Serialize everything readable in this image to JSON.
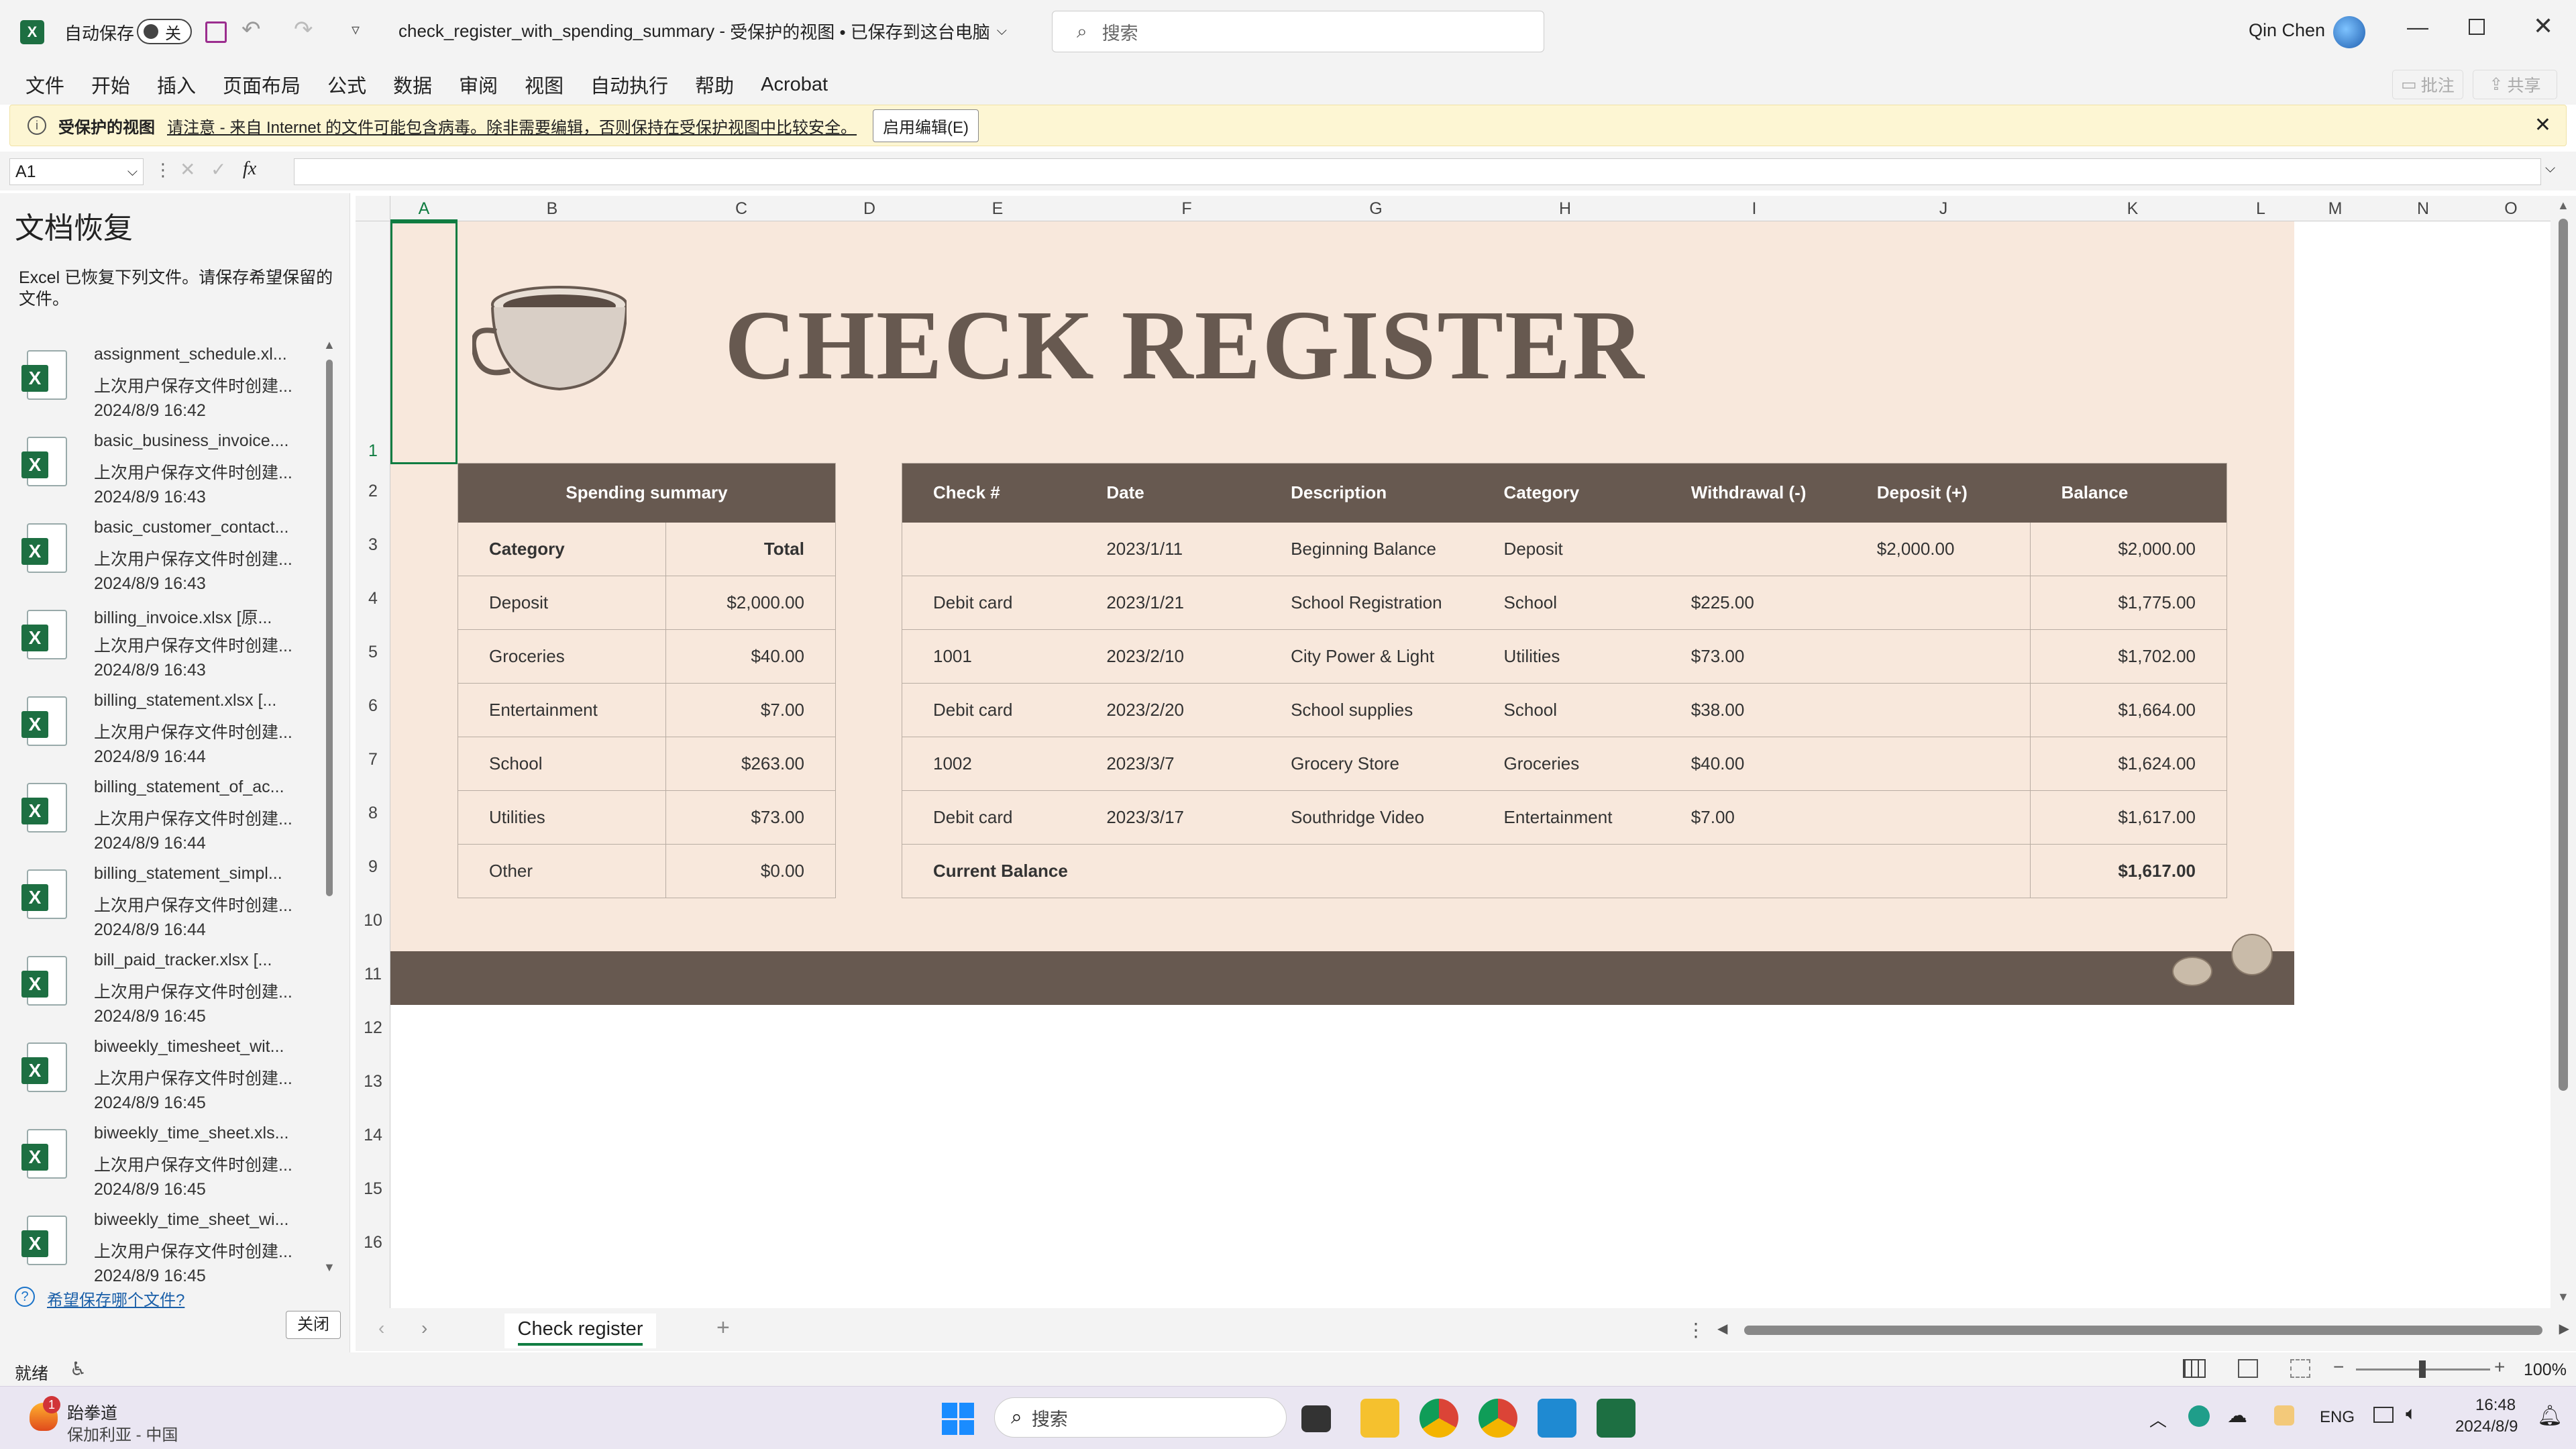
{
  "titlebar": {
    "autosave_label": "自动保存",
    "autosave_state": "关",
    "filename": "check_register_with_spending_summary",
    "title_sep": " - ",
    "view_status": "受保护的视图 • 已保存到这台电脑",
    "search_placeholder": "搜索",
    "user_name": "Qin Chen"
  },
  "menu": {
    "items": [
      "文件",
      "开始",
      "插入",
      "页面布局",
      "公式",
      "数据",
      "审阅",
      "视图",
      "自动执行",
      "帮助",
      "Acrobat"
    ],
    "comments": "批注",
    "share": "共享"
  },
  "protected": {
    "label": "受保护的视图",
    "message": "请注意 - 来自 Internet 的文件可能包含病毒。除非需要编辑，否则保持在受保护视图中比较安全。",
    "enable_button": "启用编辑(E)"
  },
  "formula": {
    "name_box": "A1",
    "fx": "fx",
    "content": ""
  },
  "recovery": {
    "title": "文档恢复",
    "description": "Excel 已恢复下列文件。请保存希望保留的文件。",
    "items": [
      {
        "name": "assignment_schedule.xl...",
        "note": "上次用户保存文件时创建...",
        "time": "2024/8/9 16:42"
      },
      {
        "name": "basic_business_invoice....",
        "note": "上次用户保存文件时创建...",
        "time": "2024/8/9 16:43"
      },
      {
        "name": "basic_customer_contact...",
        "note": "上次用户保存文件时创建...",
        "time": "2024/8/9 16:43"
      },
      {
        "name": "billing_invoice.xlsx  [原...",
        "note": "上次用户保存文件时创建...",
        "time": "2024/8/9 16:43"
      },
      {
        "name": "billing_statement.xlsx  [...",
        "note": "上次用户保存文件时创建...",
        "time": "2024/8/9 16:44"
      },
      {
        "name": "billing_statement_of_ac...",
        "note": "上次用户保存文件时创建...",
        "time": "2024/8/9 16:44"
      },
      {
        "name": "billing_statement_simpl...",
        "note": "上次用户保存文件时创建...",
        "time": "2024/8/9 16:44"
      },
      {
        "name": "bill_paid_tracker.xlsx  [...",
        "note": "上次用户保存文件时创建...",
        "time": "2024/8/9 16:45"
      },
      {
        "name": "biweekly_timesheet_wit...",
        "note": "上次用户保存文件时创建...",
        "time": "2024/8/9 16:45"
      },
      {
        "name": "biweekly_time_sheet.xls...",
        "note": "上次用户保存文件时创建...",
        "time": "2024/8/9 16:45"
      },
      {
        "name": "biweekly_time_sheet_wi...",
        "note": "上次用户保存文件时创建...",
        "time": "2024/8/9 16:45"
      }
    ],
    "which_link": "希望保存哪个文件?",
    "close_button": "关闭"
  },
  "grid": {
    "columns": [
      "A",
      "B",
      "C",
      "D",
      "E",
      "F",
      "G",
      "H",
      "I",
      "J",
      "K",
      "L",
      "M",
      "N",
      "O"
    ],
    "rows": [
      "1",
      "2",
      "3",
      "4",
      "5",
      "6",
      "7",
      "8",
      "9",
      "10",
      "11",
      "12",
      "13",
      "14",
      "15",
      "16"
    ]
  },
  "sheet": {
    "title": "CHECK REGISTER",
    "summary": {
      "header": "Spending summary",
      "col_category": "Category",
      "col_total": "Total",
      "rows": [
        {
          "category": "Deposit",
          "total": "$2,000.00"
        },
        {
          "category": "Groceries",
          "total": "$40.00"
        },
        {
          "category": "Entertainment",
          "total": "$7.00"
        },
        {
          "category": "School",
          "total": "$263.00"
        },
        {
          "category": "Utilities",
          "total": "$73.00"
        },
        {
          "category": "Other",
          "total": "$0.00"
        }
      ]
    },
    "register": {
      "headers": [
        "Check #",
        "Date",
        "Description",
        "Category",
        "Withdrawal (-)",
        "Deposit (+)",
        "Balance"
      ],
      "rows": [
        [
          "",
          "2023/1/11",
          "Beginning Balance",
          "Deposit",
          "",
          "$2,000.00",
          "$2,000.00"
        ],
        [
          "Debit card",
          "2023/1/21",
          "School Registration",
          "School",
          "$225.00",
          "",
          "$1,775.00"
        ],
        [
          "1001",
          "2023/2/10",
          "City Power & Light",
          "Utilities",
          "$73.00",
          "",
          "$1,702.00"
        ],
        [
          "Debit card",
          "2023/2/20",
          "School supplies",
          "School",
          "$38.00",
          "",
          "$1,664.00"
        ],
        [
          "1002",
          "2023/3/7",
          "Grocery Store",
          "Groceries",
          "$40.00",
          "",
          "$1,624.00"
        ],
        [
          "Debit card",
          "2023/3/17",
          "Southridge Video",
          "Entertainment",
          "$7.00",
          "",
          "$1,617.00"
        ]
      ],
      "current_label": "Current Balance",
      "current_value": "$1,617.00"
    }
  },
  "tabs": {
    "active": "Check register"
  },
  "status": {
    "ready": "就绪",
    "zoom": "100%"
  },
  "taskbar": {
    "weather_title": "跆拳道",
    "weather_sub": "保加利亚 - 中国",
    "badge": "1",
    "search": "搜索",
    "lang": "ENG",
    "time": "16:48",
    "date": "2024/8/9"
  }
}
